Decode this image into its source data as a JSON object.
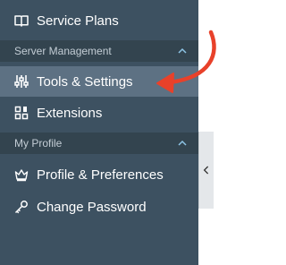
{
  "sidebar": {
    "top_item": {
      "label": "Service Plans",
      "icon": "book-icon"
    },
    "sections": [
      {
        "title": "Server Management",
        "expanded": true,
        "items": [
          {
            "label": "Tools & Settings",
            "icon": "sliders-icon",
            "active": true
          },
          {
            "label": "Extensions",
            "icon": "puzzle-icon",
            "active": false
          }
        ]
      },
      {
        "title": "My Profile",
        "expanded": true,
        "items": [
          {
            "label": "Profile & Preferences",
            "icon": "crown-icon",
            "active": false
          },
          {
            "label": "Change Password",
            "icon": "key-icon",
            "active": false
          }
        ]
      }
    ]
  },
  "colors": {
    "sidebar_bg": "#3d5161",
    "section_bg": "#33444f",
    "active_bg": "#5d7183",
    "accent": "#8ec5e6",
    "annotation_arrow": "#e8412a"
  }
}
